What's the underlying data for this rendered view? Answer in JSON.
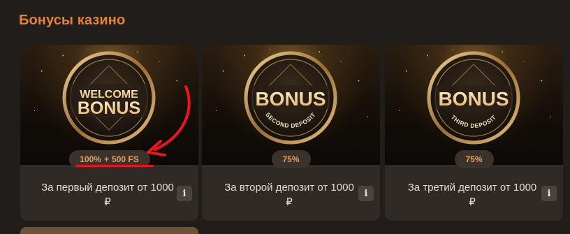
{
  "section_title": "Бонусы казино",
  "accent_color": "#e1833f",
  "arrow_color": "#e8141f",
  "cards": [
    {
      "coin_main_line1": "WELCOME",
      "coin_main_line2": "BONUS",
      "coin_sub": "",
      "badge_percent": "100%",
      "badge_plus": "+",
      "badge_fs": "500 FS",
      "description": "За первый депозит от 1000 ₽",
      "info_label": "i"
    },
    {
      "coin_main_line1": "",
      "coin_main_line2": "BONUS",
      "coin_sub": "SECOND DEPOSIT",
      "badge_percent": "75%",
      "description": "За второй депозит от 1000 ₽",
      "info_label": "i"
    },
    {
      "coin_main_line1": "",
      "coin_main_line2": "BONUS",
      "coin_sub": "THIRD DEPOSIT",
      "badge_percent": "75%",
      "description": "За третий депозит от 1000 ₽",
      "info_label": "i"
    }
  ]
}
